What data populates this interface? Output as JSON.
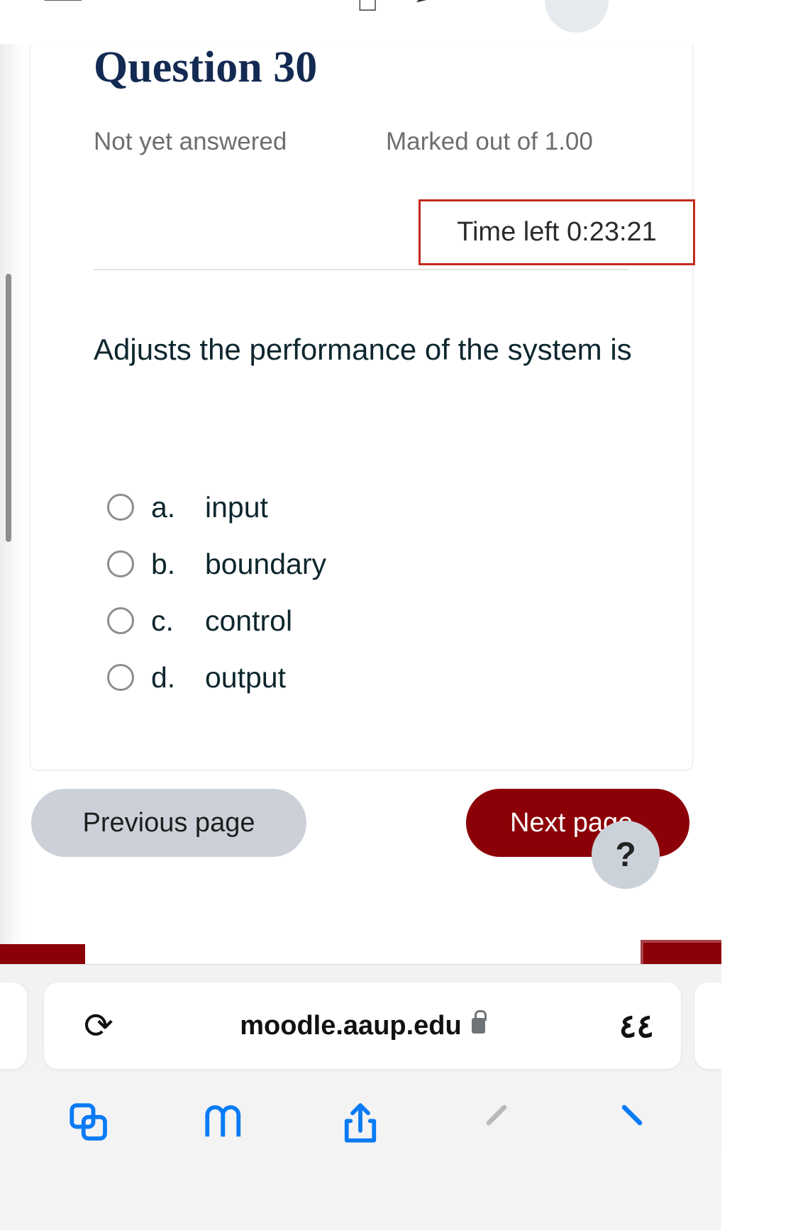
{
  "top_nav": {
    "hamburger_icon": "hamburger-menu-icon",
    "glyph_a_icon": "clipboard-icon",
    "glyph_b_icon": "chevron-right-icon",
    "avatar_icon": "user-avatar"
  },
  "question": {
    "title": "Question 30",
    "state": "Not yet answered",
    "marks": "Marked out of 1.00",
    "timer": "Time left 0:23:21",
    "text": "Adjusts the performance of the system is",
    "answers": [
      {
        "letter": "a.",
        "label": "input",
        "selected": false
      },
      {
        "letter": "b.",
        "label": "boundary",
        "selected": false
      },
      {
        "letter": "c.",
        "label": "control",
        "selected": false
      },
      {
        "letter": "d.",
        "label": "output",
        "selected": false
      }
    ]
  },
  "navigation": {
    "previous_label": "Previous page",
    "next_label": "Next page",
    "help_label": "?"
  },
  "browser": {
    "reload_icon": "reload-icon",
    "url": "moodle.aaup.edu",
    "lock_icon": "lock-icon",
    "tab_count": "٤٤",
    "toolbar": [
      {
        "name": "tabs-icon"
      },
      {
        "name": "bookmarks-icon"
      },
      {
        "name": "share-icon"
      },
      {
        "name": "back-icon"
      },
      {
        "name": "forward-icon"
      }
    ]
  },
  "colors": {
    "brand_red": "#8c0007",
    "timer_border": "#c32a1d",
    "title_navy": "#132a52",
    "text_slate": "#0e262e",
    "muted_gray": "#6e6e6e",
    "button_gray": "#ccd1d9",
    "browser_blue": "#0a7bf5"
  }
}
